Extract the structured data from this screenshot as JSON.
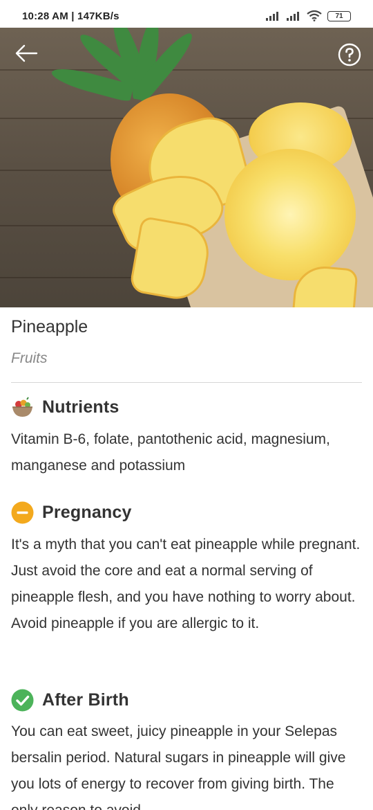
{
  "status_bar": {
    "time": "10:28 AM | 147KB/s",
    "battery": "71"
  },
  "header": {
    "back_icon": "arrow-left-icon",
    "help_icon": "question-circle-icon"
  },
  "food": {
    "name": "Pineapple",
    "category": "Fruits"
  },
  "sections": {
    "nutrients": {
      "icon": "food-bowl-icon",
      "title": "Nutrients",
      "body": "Vitamin B-6, folate, pantothenic acid, magnesium, manganese and potassium"
    },
    "pregnancy": {
      "icon": "minus-circle-icon",
      "icon_color": "#f3a91d",
      "title": "Pregnancy",
      "body": "It's a myth that you can't eat pineapple while pregnant. Just avoid the core and eat a normal serving of pineapple flesh, and you have nothing to worry about.  Avoid pineapple if you are allergic to it."
    },
    "after_birth": {
      "icon": "check-circle-icon",
      "icon_color": "#4cb35a",
      "title": "After Birth",
      "body": "You can eat sweet, juicy pineapple in your Selepas bersalin period. Natural sugars in pineapple will give you lots of energy to recover from giving birth. The only reason to avoid"
    }
  }
}
